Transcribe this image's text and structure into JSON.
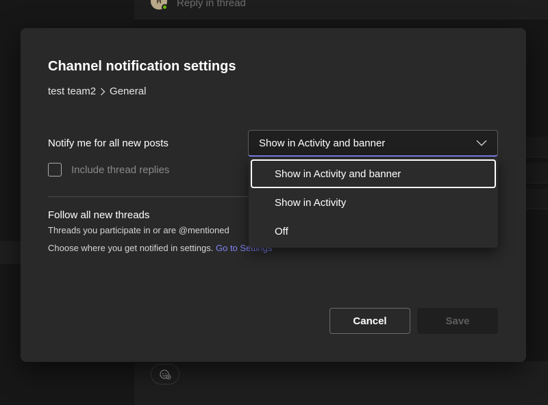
{
  "background": {
    "reply_avatar_initial": "H",
    "reply_placeholder": "Reply in thread",
    "emoji_icon": "emoji-icon"
  },
  "dialog": {
    "title": "Channel notification settings",
    "breadcrumb": {
      "team": "test team2",
      "separator_icon": "chevron-right-icon",
      "channel": "General"
    },
    "notify": {
      "label": "Notify me for all new posts",
      "selected_value": "Show in Activity and banner",
      "options": [
        "Show in Activity and banner",
        "Show in Activity",
        "Off"
      ],
      "selected_index": 0
    },
    "include_thread_replies": {
      "label": "Include thread replies",
      "checked": false
    },
    "follow": {
      "title": "Follow all new threads",
      "line1": "Threads you participate in or are @mentioned",
      "line2_prefix": "Choose where you get notified in settings. ",
      "link": "Go to Settings"
    },
    "buttons": {
      "cancel": "Cancel",
      "save": "Save"
    }
  },
  "colors": {
    "accent": "#7f85f5",
    "dialog_bg": "#292929",
    "link": "#7f85f5"
  }
}
